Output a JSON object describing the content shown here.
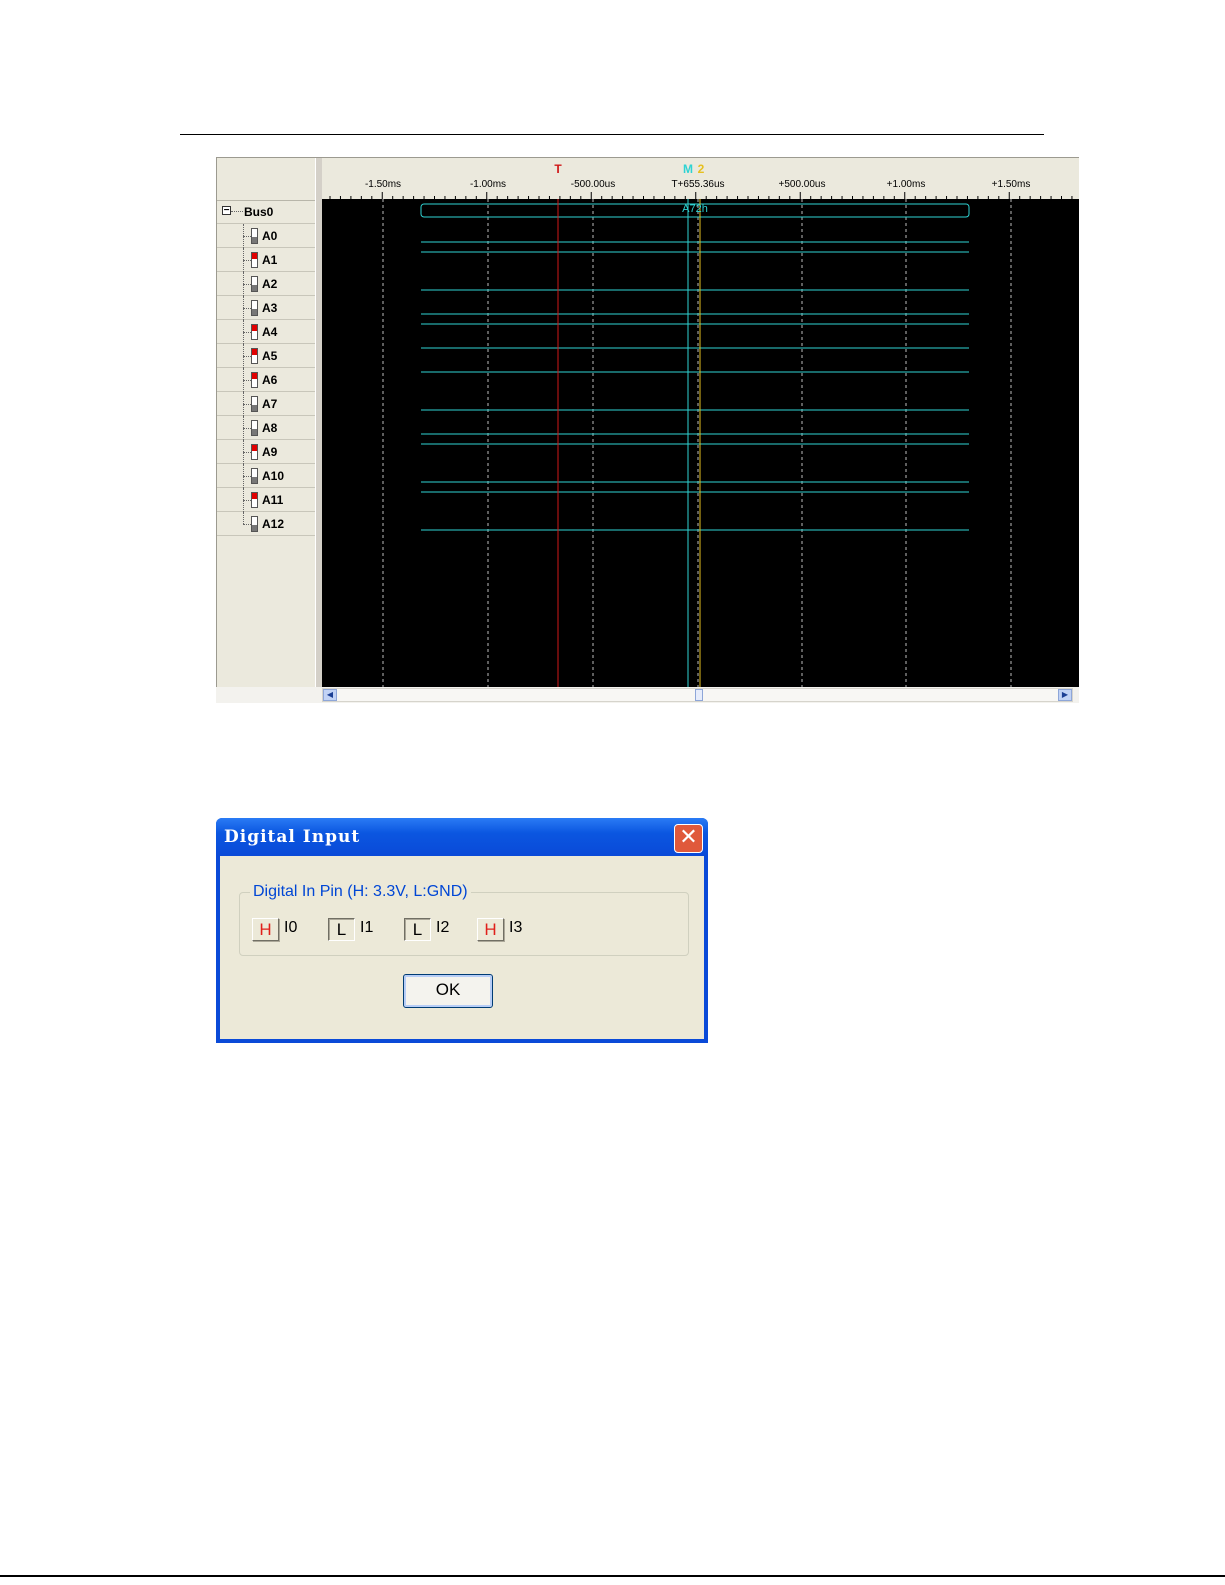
{
  "analyzer": {
    "bus": {
      "label": "Bus0",
      "expander": "⊟"
    },
    "channels": [
      {
        "label": "A0",
        "state": "low"
      },
      {
        "label": "A1",
        "state": "high"
      },
      {
        "label": "A2",
        "state": "low"
      },
      {
        "label": "A3",
        "state": "low"
      },
      {
        "label": "A4",
        "state": "high"
      },
      {
        "label": "A5",
        "state": "high"
      },
      {
        "label": "A6",
        "state": "high"
      },
      {
        "label": "A7",
        "state": "low"
      },
      {
        "label": "A8",
        "state": "low"
      },
      {
        "label": "A9",
        "state": "high"
      },
      {
        "label": "A10",
        "state": "low"
      },
      {
        "label": "A11",
        "state": "high"
      },
      {
        "label": "A12",
        "state": "low"
      }
    ],
    "time_labels": [
      "-1.50ms",
      "-1.00ms",
      "-500.00us",
      "T+655.36us",
      "+500.00us",
      "+1.00ms",
      "+1.50ms"
    ],
    "markers": {
      "trigger": "T",
      "m1": "M",
      "m2": "2"
    },
    "bus_value": "A72h",
    "colors": {
      "trace": "#2fd3d3",
      "trigger": "#d01818",
      "m1": "#2fd3d3",
      "m2": "#e6c020",
      "high_indicator": "#e00000"
    }
  },
  "dialog": {
    "title": "Digital Input",
    "close_glyph": "✕",
    "group_label": "Digital In Pin (H: 3.3V, L:GND)",
    "pins": [
      {
        "state": "H",
        "name": "I0"
      },
      {
        "state": "L",
        "name": "I1"
      },
      {
        "state": "L",
        "name": "I2"
      },
      {
        "state": "H",
        "name": "I3"
      }
    ],
    "ok_label": "OK"
  }
}
